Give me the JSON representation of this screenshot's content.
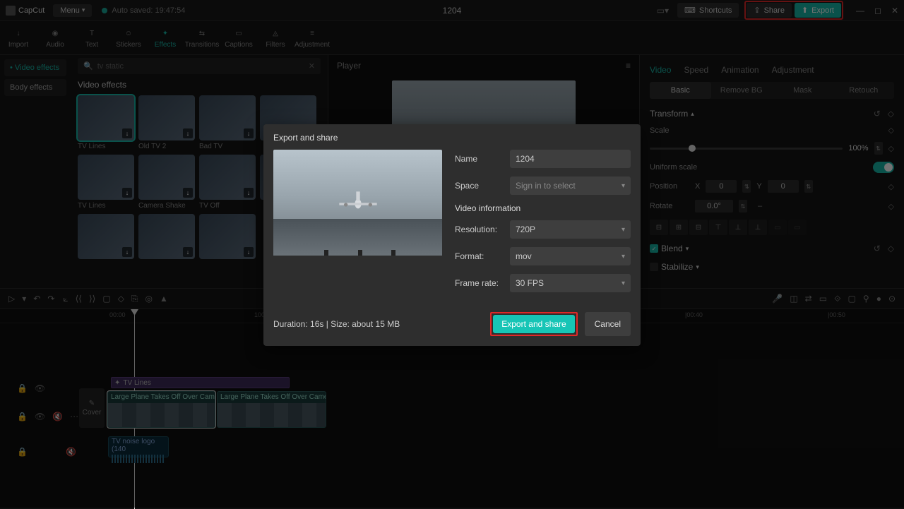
{
  "app": {
    "name": "CapCut",
    "menu_label": "Menu",
    "autosave": "Auto saved: 19:47:54",
    "project_title": "1204"
  },
  "topbar": {
    "shortcuts": "Shortcuts",
    "share": "Share",
    "export": "Export"
  },
  "tooltabs": [
    {
      "label": "Import",
      "icon": "↓"
    },
    {
      "label": "Audio",
      "icon": "◉"
    },
    {
      "label": "Text",
      "icon": "T"
    },
    {
      "label": "Stickers",
      "icon": "☺"
    },
    {
      "label": "Effects",
      "icon": "✦",
      "active": true
    },
    {
      "label": "Transitions",
      "icon": "⇆"
    },
    {
      "label": "Captions",
      "icon": "▭"
    },
    {
      "label": "Filters",
      "icon": "◬"
    },
    {
      "label": "Adjustment",
      "icon": "≡"
    }
  ],
  "effects_panel": {
    "tabs": [
      {
        "label": "Video effects",
        "active": true
      },
      {
        "label": "Body effects"
      }
    ],
    "search": "tv static",
    "title": "Video effects",
    "items": [
      {
        "label": "TV Lines",
        "sel": true
      },
      {
        "label": "Old TV 2"
      },
      {
        "label": "Bad TV"
      },
      {
        "label": ""
      },
      {
        "label": "TV Lines"
      },
      {
        "label": "Camera Shake"
      },
      {
        "label": "TV Off"
      },
      {
        "label": ""
      },
      {
        "label": ""
      },
      {
        "label": ""
      },
      {
        "label": ""
      }
    ]
  },
  "player": {
    "title": "Player"
  },
  "props": {
    "tabs": [
      "Video",
      "Speed",
      "Animation",
      "Adjustment"
    ],
    "subtabs": [
      "Basic",
      "Remove BG",
      "Mask",
      "Retouch"
    ],
    "transform": "Transform",
    "scale": "Scale",
    "scale_val": "100%",
    "uniform": "Uniform scale",
    "position": "Position",
    "pos_x_label": "X",
    "pos_x": "0",
    "pos_y_label": "Y",
    "pos_y": "0",
    "rotate": "Rotate",
    "rotate_val": "0.0°",
    "blend": "Blend",
    "stabilize": "Stabilize"
  },
  "timeline": {
    "ticks": [
      "00:00",
      "100",
      "|00:40",
      "|00:50"
    ],
    "fx_clip": "TV Lines",
    "video_clip": "Large Plane Takes Off Over Camera",
    "audio_clip": "TV noise logo (140",
    "cover": "Cover"
  },
  "modal": {
    "title": "Export and share",
    "name_label": "Name",
    "name_value": "1204",
    "space_label": "Space",
    "space_value": "Sign in to select",
    "section_title": "Video information",
    "resolution_label": "Resolution:",
    "resolution_value": "720P",
    "format_label": "Format:",
    "format_value": "mov",
    "framerate_label": "Frame rate:",
    "framerate_value": "30 FPS",
    "duration": "Duration: 16s | Size: about 15 MB",
    "primary": "Export and share",
    "cancel": "Cancel"
  }
}
